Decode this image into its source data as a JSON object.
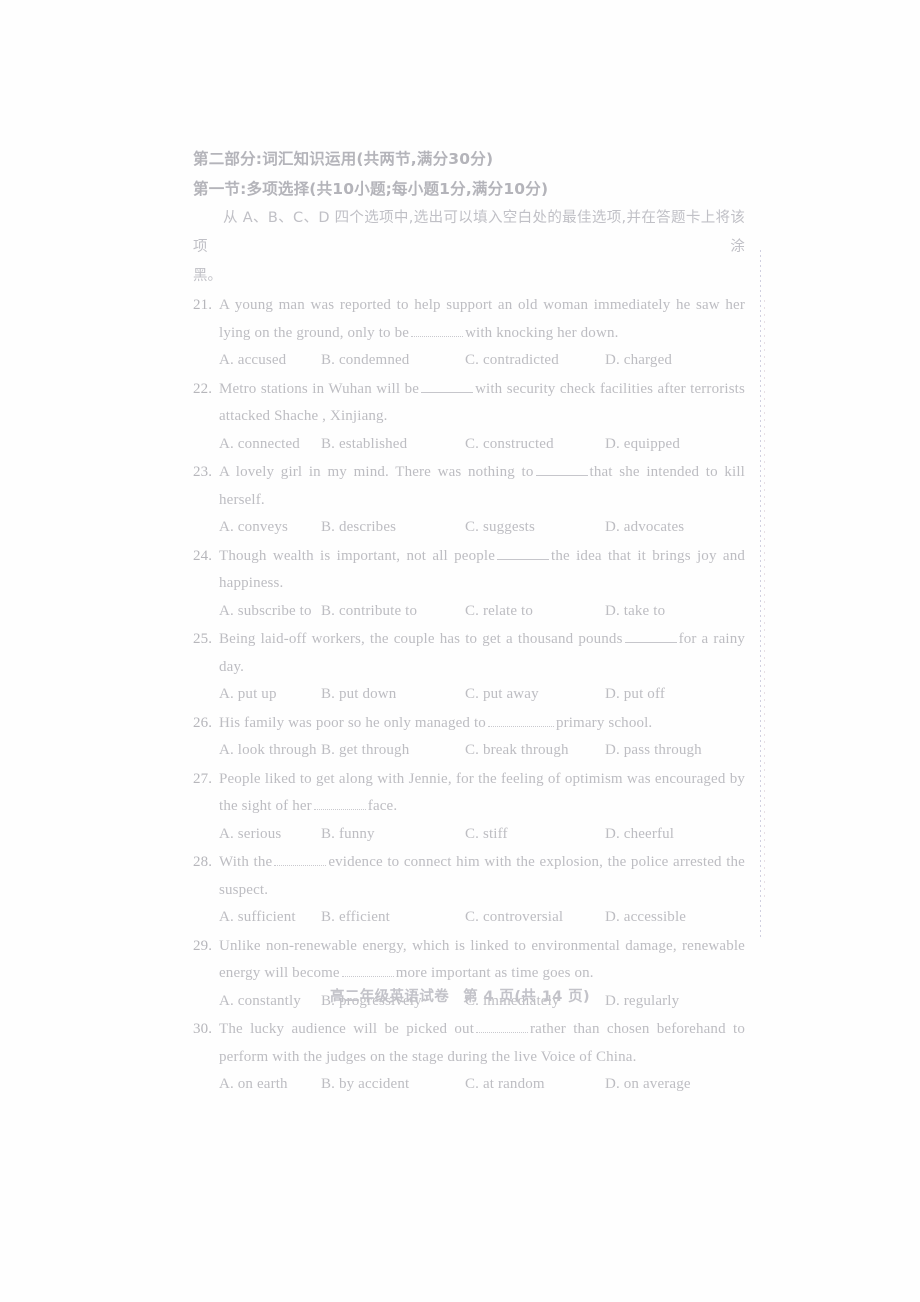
{
  "document": {
    "section_heading": "第二部分:词汇知识运用(共两节,满分30分)",
    "subsection_heading": "第一节:多项选择(共10小题;每小题1分,满分10分)",
    "instruction_line1": "从 A、B、C、D 四个选项中,选出可以填入空白处的最佳选项,并在答题卡上将该项涂",
    "instruction_line2": "黑。",
    "footer_title": "高二年级英语试卷",
    "footer_page": "第 4 页(共 14 页)"
  },
  "questions": [
    {
      "number": "21.",
      "stem_before": "A young man was reported to help support an old woman immediately he saw her lying on the ground, only to be",
      "stem_after": "with knocking her down.",
      "options": {
        "a": "A. accused",
        "b": "B. condemned",
        "c": "C. contradicted",
        "d": "D. charged"
      }
    },
    {
      "number": "22.",
      "stem_before": "Metro stations in Wuhan will be",
      "stem_after": "with security check facilities after terrorists attacked Shache , Xinjiang.",
      "options": {
        "a": "A. connected",
        "b": "B. established",
        "c": "C. constructed",
        "d": "D. equipped"
      }
    },
    {
      "number": "23.",
      "stem_before": "A lovely girl in my mind. There was nothing to",
      "stem_after": "that she intended to kill herself.",
      "options": {
        "a": "A. conveys",
        "b": "B. describes",
        "c": "C. suggests",
        "d": "D. advocates"
      }
    },
    {
      "number": "24.",
      "stem_before": "Though wealth is important, not all people",
      "stem_after": "the idea that it brings joy and happiness.",
      "options": {
        "a": "A. subscribe to",
        "b": "B. contribute to",
        "c": "C. relate to",
        "d": "D. take to"
      }
    },
    {
      "number": "25.",
      "stem_before": "Being laid-off workers, the couple has to get a thousand pounds",
      "stem_after": "for a rainy day.",
      "options": {
        "a": "A. put up",
        "b": "B. put down",
        "c": "C. put away",
        "d": "D. put off"
      }
    },
    {
      "number": "26.",
      "stem_before": "His family was poor so he only managed to",
      "stem_after": "primary school.",
      "options": {
        "a": "A. look through",
        "b": "B. get through",
        "c": "C. break through",
        "d": "D. pass through"
      }
    },
    {
      "number": "27.",
      "stem_before": "People liked to get along with Jennie, for the feeling of optimism was encouraged by the sight of her",
      "stem_after": "face.",
      "options": {
        "a": "A. serious",
        "b": "B. funny",
        "c": "C. stiff",
        "d": "D. cheerful"
      }
    },
    {
      "number": "28.",
      "stem_before": "With the",
      "stem_after": "evidence to connect him with the explosion, the police arrested the suspect.",
      "options": {
        "a": "A. sufficient",
        "b": "B. efficient",
        "c": "C. controversial",
        "d": "D. accessible"
      }
    },
    {
      "number": "29.",
      "stem_before": "Unlike non-renewable energy, which is linked to environmental damage, renewable energy will become",
      "stem_after": "more important as time goes on.",
      "options": {
        "a": "A. constantly",
        "b": "B. progressively",
        "c": "C. immediately",
        "d": "D. regularly"
      }
    },
    {
      "number": "30.",
      "stem_before": "The lucky audience will be picked out",
      "stem_after": "rather than chosen beforehand to perform with the judges on the stage during the live Voice of China.",
      "options": {
        "a": "A. on earth",
        "b": "B. by accident",
        "c": "C. at random",
        "d": "D. on average"
      }
    }
  ]
}
